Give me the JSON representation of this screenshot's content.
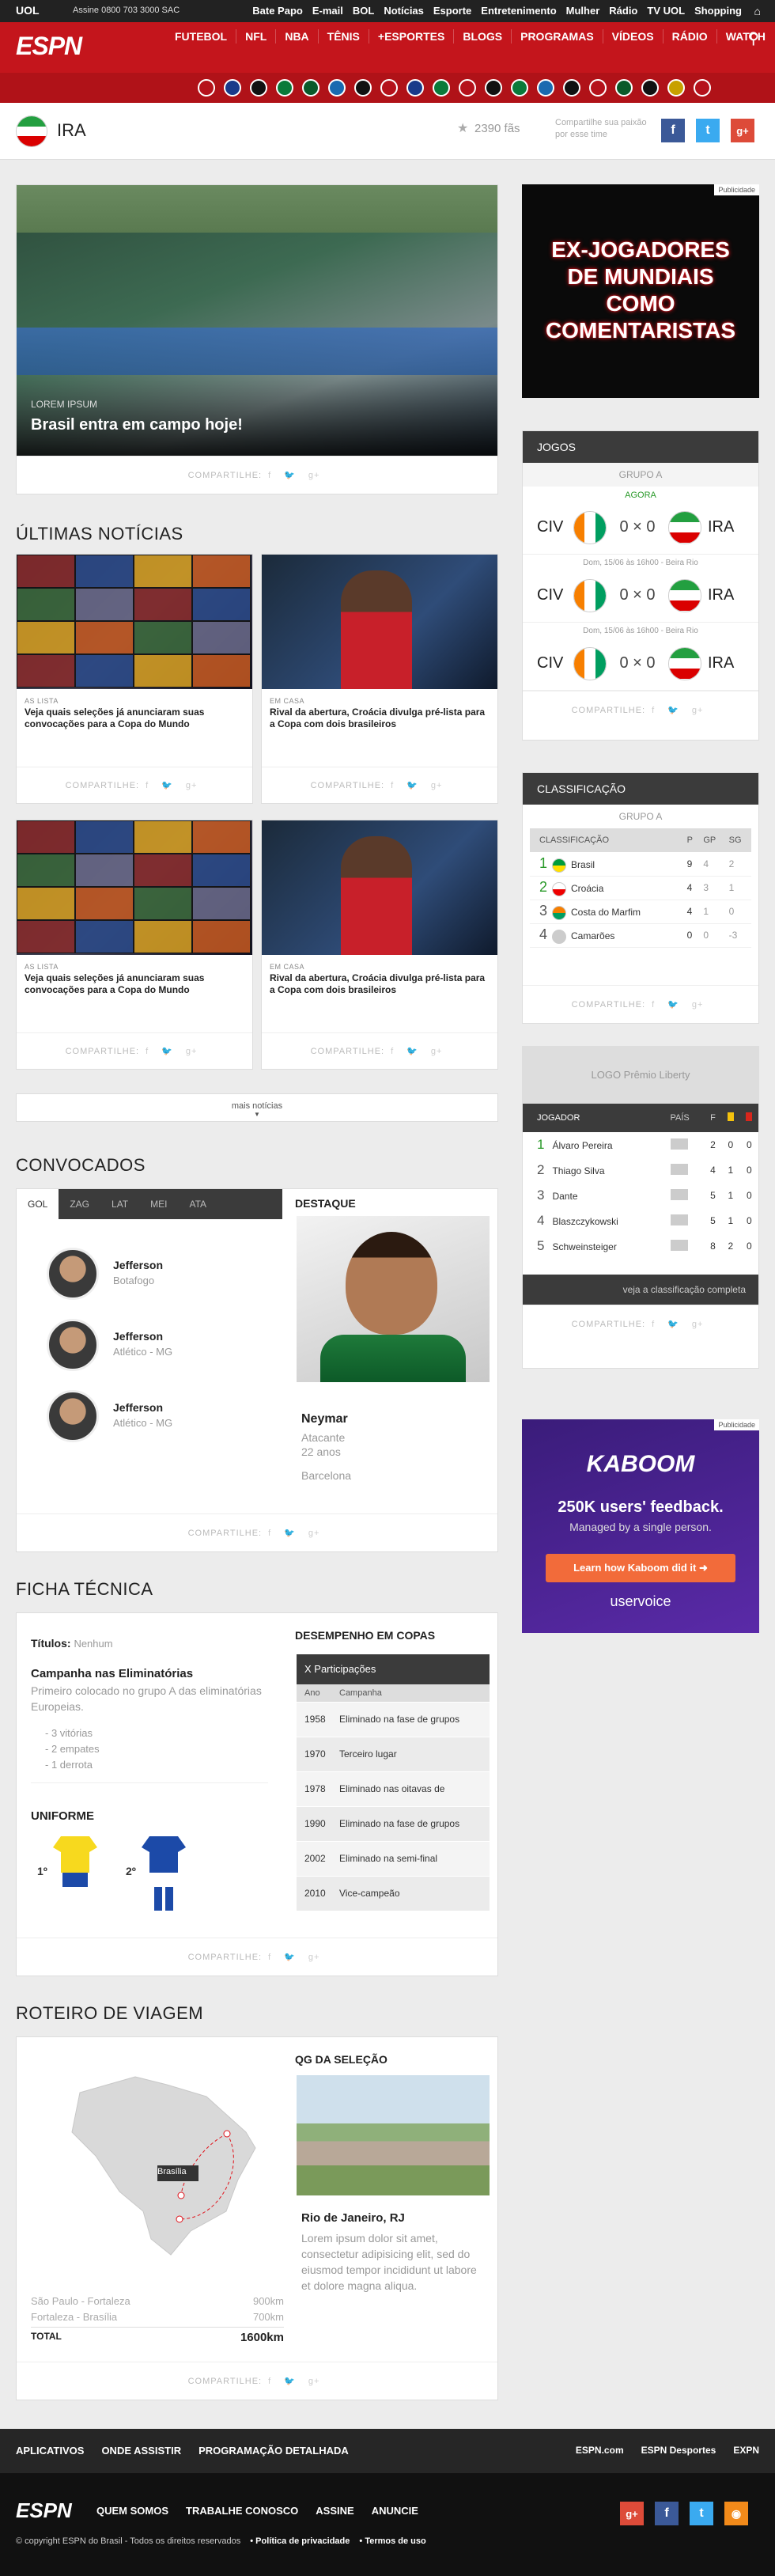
{
  "uol": {
    "logo": "UOL",
    "sac": "Assine 0800 703 3000  SAC",
    "links": [
      "Bate Papo",
      "E-mail",
      "BOL",
      "Notícias",
      "Esporte",
      "Entretenimento",
      "Mulher",
      "Rádio",
      "TV UOL",
      "Shopping"
    ]
  },
  "header": {
    "brand": "ESPN",
    "nav": [
      "FUTEBOL",
      "NFL",
      "NBA",
      "TÊNIS",
      "+ESPORTES",
      "BLOGS",
      "PROGRAMAS",
      "VÍDEOS",
      "RÁDIO",
      "WATCH"
    ],
    "club_colors": [
      "#b5121b",
      "#1a3a8a",
      "#111",
      "#0a7a3a",
      "#0a5a2a",
      "#1a6ab0",
      "#111",
      "#b5121b",
      "#1a3a8a",
      "#0a7a3a",
      "#b5121b",
      "#111",
      "#0a7a3a",
      "#1a6ab0",
      "#111",
      "#b5121b",
      "#0a5a2a",
      "#111",
      "#c8a000",
      "#b5121b"
    ]
  },
  "team": {
    "name": "IRA",
    "fans": "2390 fãs",
    "share_text": "Compartilhe sua paixão por esse time",
    "social": [
      "f",
      "t",
      "g+"
    ]
  },
  "hero": {
    "tag": "LOREM IPSUM",
    "title": "Brasil entra em campo hoje!",
    "share": "COMPARTILHE:"
  },
  "ad1": {
    "label": "Publicidade",
    "text": "EX-JOGADORES DE MUNDIAIS COMO COMENTARISTAS"
  },
  "news": {
    "title": "ÚLTIMAS NOTÍCIAS",
    "items": [
      {
        "tag": "AS LISTA",
        "title": "Veja quais seleções já anunciaram suas convocações para a Copa do Mundo"
      },
      {
        "tag": "EM CASA",
        "title": "Rival da abertura, Croácia divulga pré-lista para a Copa com dois brasileiros"
      },
      {
        "tag": "AS LISTA",
        "title": "Veja quais seleções já anunciaram suas convocações para a Copa do Mundo"
      },
      {
        "tag": "EM CASA",
        "title": "Rival da abertura, Croácia divulga pré-lista para a Copa com dois brasileiros"
      }
    ],
    "more": "mais notícias",
    "share": "COMPARTILHE:"
  },
  "jogos": {
    "title": "JOGOS",
    "group": "GRUPO A",
    "matches": [
      {
        "status": "AGORA",
        "home": "CIV",
        "score": "0 × 0",
        "away": "IRA"
      },
      {
        "status": "Dom, 15/06 às 16h00 - Beira Rio",
        "home": "CIV",
        "score": "0 × 0",
        "away": "IRA"
      },
      {
        "status": "Dom, 15/06 às 16h00 - Beira Rio",
        "home": "CIV",
        "score": "0 × 0",
        "away": "IRA"
      }
    ],
    "share": "COMPARTILHE:"
  },
  "classif": {
    "title": "CLASSIFICAÇÃO",
    "group": "GRUPO A",
    "headers": [
      "CLASSIFICAÇÃO",
      "P",
      "GP",
      "SG"
    ],
    "rows": [
      {
        "pos": "1",
        "team": "Brasil",
        "p": "9",
        "gp": "4",
        "sg": "2"
      },
      {
        "pos": "2",
        "team": "Croácia",
        "p": "4",
        "gp": "3",
        "sg": "1"
      },
      {
        "pos": "3",
        "team": "Costa do Marfim",
        "p": "4",
        "gp": "1",
        "sg": "0"
      },
      {
        "pos": "4",
        "team": "Camarões",
        "p": "0",
        "gp": "0",
        "sg": "-3"
      }
    ],
    "share": "COMPARTILHE:"
  },
  "premio": {
    "logo": "LOGO Prêmio Liberty",
    "headers": [
      "JOGADOR",
      "PAÍS",
      "F"
    ],
    "rows": [
      {
        "pos": "1",
        "name": "Álvaro Pereira",
        "f": "2",
        "y": "0",
        "r": "0"
      },
      {
        "pos": "2",
        "name": "Thiago Silva",
        "f": "4",
        "y": "1",
        "r": "0"
      },
      {
        "pos": "3",
        "name": "Dante",
        "f": "5",
        "y": "1",
        "r": "0"
      },
      {
        "pos": "4",
        "name": "Blaszczykowski",
        "f": "5",
        "y": "1",
        "r": "0"
      },
      {
        "pos": "5",
        "name": "Schweinsteiger",
        "f": "8",
        "y": "2",
        "r": "0"
      }
    ],
    "link": "veja a classificação completa",
    "share": "COMPARTILHE:"
  },
  "ad2": {
    "label": "Publicidade",
    "brand": "KABOOM",
    "headline": "250K users' feedback.",
    "sub": "Managed by a single person.",
    "cta": "Learn how Kaboom did it",
    "footer": "uservoice"
  },
  "convocados": {
    "title": "CONVOCADOS",
    "tabs": [
      "GOL",
      "ZAG",
      "LAT",
      "MEI",
      "ATA"
    ],
    "players": [
      {
        "name": "Jefferson",
        "club": "Botafogo"
      },
      {
        "name": "Jefferson",
        "club": "Atlético - MG"
      },
      {
        "name": "Jefferson",
        "club": "Atlético - MG"
      }
    ],
    "destaque": {
      "label": "DESTAQUE",
      "name": "Neymar",
      "pos": "Atacante",
      "age": "22 anos",
      "club": "Barcelona"
    },
    "share": "COMPARTILHE:"
  },
  "ficha": {
    "title": "FICHA TÉCNICA",
    "titulos_label": "Títulos:",
    "titulos_value": "Nenhum",
    "camp_title": "Campanha nas Eliminatórias",
    "camp_text": "Primeiro colocado no grupo A das eliminatórias Europeias.",
    "camp_list": [
      "- 3 vitórias",
      "- 2 empates",
      "- 1 derrota"
    ],
    "uniforme": "UNIFORME",
    "uni1": "1º",
    "uni2": "2º",
    "desempenho": "DESEMPENHO EM COPAS",
    "participacoes": "X Participações",
    "cols": [
      "Ano",
      "Campanha"
    ],
    "rows": [
      {
        "ano": "1958",
        "camp": "Eliminado na fase de grupos"
      },
      {
        "ano": "1970",
        "camp": "Terceiro lugar"
      },
      {
        "ano": "1978",
        "camp": "Eliminado nas oitavas de"
      },
      {
        "ano": "1990",
        "camp": "Eliminado na fase de grupos"
      },
      {
        "ano": "2002",
        "camp": "Eliminado na semi-final"
      },
      {
        "ano": "2010",
        "camp": "Vice-campeão"
      }
    ],
    "share": "COMPARTILHE:"
  },
  "roteiro": {
    "title": "ROTEIRO DE VIAGEM",
    "city": "Brasília",
    "routes": [
      {
        "label": "São Paulo - Fortaleza",
        "km": "900km"
      },
      {
        "label": "Fortaleza - Brasília",
        "km": "700km"
      }
    ],
    "total_label": "TOTAL",
    "total": "1600km",
    "qg_title": "QG DA SELEÇÃO",
    "qg_city": "Rio de Janeiro, RJ",
    "qg_text": "Lorem ipsum dolor sit amet, consectetur adipisicing elit, sed do eiusmod tempor incididunt ut labore et dolore magna aliqua.",
    "share": "COMPARTILHE:"
  },
  "footer": {
    "links": [
      "APLICATIVOS",
      "ONDE ASSISTIR",
      "PROGRAMAÇÃO DETALHADA"
    ],
    "right": [
      "ESPN.com",
      "ESPN Desportes",
      "EXPN"
    ],
    "brand": "ESPN",
    "nav": [
      "QUEM SOMOS",
      "TRABALHE CONOSCO",
      "ASSINE",
      "ANUNCIE"
    ],
    "copyright": "© copyright ESPN do Brasil - Todos os direitos reservados",
    "privacy": "Política de privacidade",
    "terms": "Termos de uso"
  }
}
